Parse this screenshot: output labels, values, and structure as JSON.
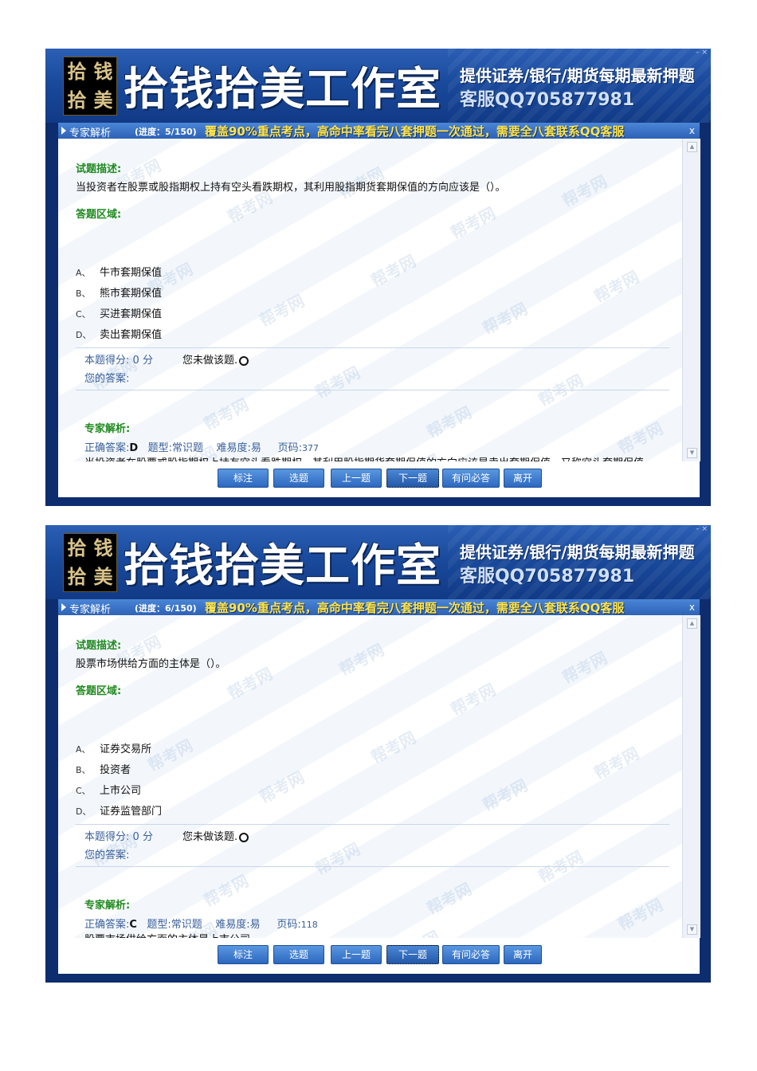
{
  "header": {
    "logo_chars": [
      "拾",
      "钱",
      "拾",
      "美"
    ],
    "studio_name": "拾钱拾美工作室",
    "slogan": "提供证券/银行/期货每期最新押题",
    "contact": "客服QQ705877981"
  },
  "window": {
    "title": "专家解析",
    "close_label": "x",
    "notice": "覆盖90%重点考点，高命中率看完八套押题一次通过，需要全八套联系QQ客服"
  },
  "labels": {
    "question_desc": "试题描述:",
    "answer_area": "答题区域:",
    "score_prefix": "本题得分:",
    "score_unit": "分",
    "not_done": "您未做该题.",
    "your_answer": "您的答案:",
    "expert_analysis": "专家解析:",
    "correct_answer": "正确答案:",
    "type_label": "题型:",
    "difficulty_label": "难易度:",
    "page_label": "页码:"
  },
  "watermark": "帮考网",
  "buttons": [
    "标注",
    "选题",
    "上一题",
    "下一题",
    "有问必答",
    "离开"
  ],
  "colors": {
    "banner": "#1a4a9c",
    "titlebar": "#3a74c8",
    "notice": "#ffe44a",
    "section_label": "#1f8a1f",
    "meta_text": "#3a5f9a",
    "button": "#3f7fd0"
  },
  "screens": [
    {
      "progress": "(进度：5/150)",
      "question": "当投资者在股票或股指期权上持有空头看跌期权，其利用股指期货套期保值的方向应该是（）。",
      "options": [
        {
          "letter": "A、",
          "text": "牛市套期保值"
        },
        {
          "letter": "B、",
          "text": "熊市套期保值"
        },
        {
          "letter": "C、",
          "text": "买进套期保值"
        },
        {
          "letter": "D、",
          "text": "卖出套期保值"
        }
      ],
      "score": "0",
      "correct": "D",
      "type": "常识题",
      "difficulty": "易",
      "page": "377",
      "explanation": "当投资者在股票或股指期权上持有空头看跌期权，其利用股指期货套期保值的方向应该是卖出套期保值，又称空头套期保值。"
    },
    {
      "progress": "(进度：6/150)",
      "question": "股票市场供给方面的主体是（）。",
      "options": [
        {
          "letter": "A、",
          "text": "证券交易所"
        },
        {
          "letter": "B、",
          "text": "投资者"
        },
        {
          "letter": "C、",
          "text": "上市公司"
        },
        {
          "letter": "D、",
          "text": "证券监管部门"
        }
      ],
      "score": "0",
      "correct": "C",
      "type": "常识题",
      "difficulty": "易",
      "page": "118",
      "explanation": "股票市场供给方面的主体是上市公司。"
    }
  ]
}
